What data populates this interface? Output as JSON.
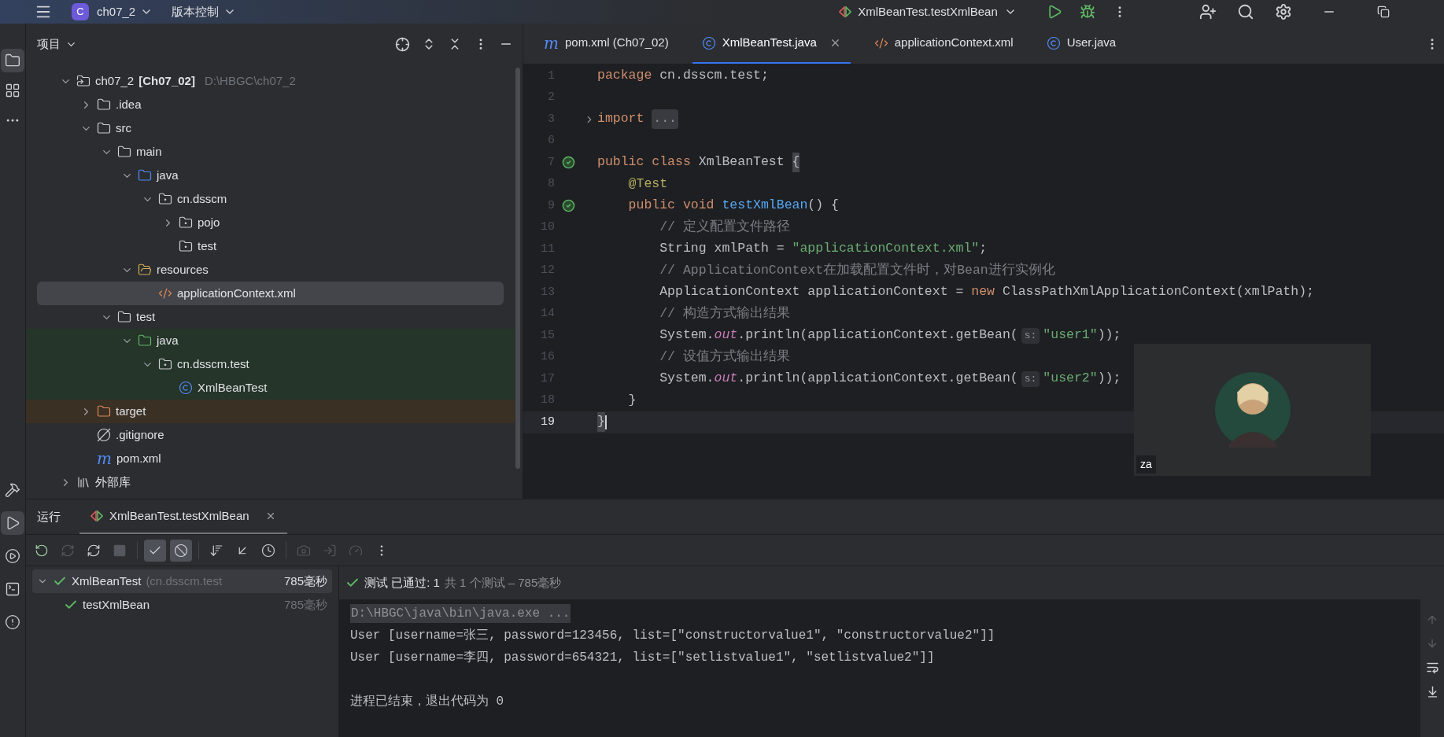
{
  "title_bar": {
    "project_badge": "C",
    "project": "ch07_2",
    "vcs": "版本控制",
    "run_config": "XmlBeanTest.testXmlBean"
  },
  "tool_strip": {
    "top": [
      {
        "kind": "project",
        "selected": true
      },
      {
        "kind": "structure",
        "selected": false
      },
      {
        "kind": "more",
        "selected": false
      }
    ],
    "bottom": [
      {
        "kind": "build",
        "selected": false
      },
      {
        "kind": "run",
        "selected": true
      },
      {
        "kind": "services",
        "selected": false
      },
      {
        "kind": "terminal",
        "selected": false
      },
      {
        "kind": "problems",
        "selected": false
      }
    ]
  },
  "project_panel": {
    "title": "项目",
    "tree": [
      {
        "label": "ch07_2",
        "bold": "[Ch07_02]",
        "path": "D:\\HBGC\\ch07_2",
        "kind": "module",
        "expanded": true,
        "selected": false,
        "children": [
          {
            "label": ".idea",
            "kind": "folder",
            "expanded": false,
            "selected": false
          },
          {
            "label": "src",
            "kind": "folder",
            "expanded": true,
            "selected": false,
            "children": [
              {
                "label": "main",
                "kind": "folder",
                "expanded": true,
                "selected": false,
                "children": [
                  {
                    "label": "java",
                    "kind": "source-folder",
                    "expanded": true,
                    "selected": false,
                    "children": [
                      {
                        "label": "cn.dsscm",
                        "kind": "package",
                        "expanded": true,
                        "selected": false,
                        "children": [
                          {
                            "label": "pojo",
                            "kind": "package",
                            "expanded": false,
                            "selected": false
                          },
                          {
                            "label": "test",
                            "kind": "package",
                            "selected": false
                          }
                        ]
                      }
                    ]
                  },
                  {
                    "label": "resources",
                    "kind": "resources",
                    "expanded": true,
                    "selected": false,
                    "children": [
                      {
                        "label": "applicationContext.xml",
                        "kind": "xml",
                        "selected": true
                      }
                    ]
                  }
                ]
              },
              {
                "label": "test",
                "kind": "folder",
                "expanded": true,
                "selected": false,
                "children": [
                  {
                    "label": "java",
                    "kind": "test-folder",
                    "expanded": true,
                    "selected": false,
                    "children": [
                      {
                        "label": "cn.dsscm.test",
                        "kind": "package",
                        "expanded": true,
                        "selected": false,
                        "children": [
                          {
                            "label": "XmlBeanTest",
                            "kind": "class",
                            "selected": false
                          }
                        ]
                      }
                    ]
                  }
                ]
              }
            ]
          },
          {
            "label": "target",
            "kind": "excluded-folder",
            "expanded": false,
            "selected": false
          },
          {
            "label": ".gitignore",
            "kind": "ignore",
            "selected": false
          },
          {
            "label": "pom.xml",
            "kind": "maven",
            "badge": "m",
            "selected": false
          }
        ]
      },
      {
        "label": "外部库",
        "kind": "library",
        "expanded": false,
        "selected": false
      }
    ]
  },
  "editor": {
    "tabs": [
      {
        "label": "pom.xml (Ch07_02)",
        "kind": "maven",
        "badge": "m",
        "selected": false,
        "closable": false
      },
      {
        "label": "XmlBeanTest.java",
        "kind": "class",
        "selected": true,
        "closable": true
      },
      {
        "label": "applicationContext.xml",
        "kind": "xml",
        "selected": false,
        "closable": false
      },
      {
        "label": "User.java",
        "kind": "class",
        "selected": false,
        "closable": false
      }
    ],
    "lines": [
      {
        "number": "1",
        "current": false,
        "tokens": [
          {
            "text": "package ",
            "kind": "keyword"
          },
          {
            "text": "cn.dsscm.test;",
            "kind": "plain"
          }
        ]
      },
      {
        "number": "2",
        "current": false
      },
      {
        "number": "3",
        "current": false,
        "folded": true,
        "tokens": [
          {
            "text": "import ",
            "kind": "keyword"
          },
          {
            "text": "...",
            "kind": "folded"
          }
        ]
      },
      {
        "number": "6",
        "current": false
      },
      {
        "number": "7",
        "current": false,
        "run_marker": true,
        "tokens": [
          {
            "text": "public class ",
            "kind": "keyword"
          },
          {
            "text": "XmlBeanTest ",
            "kind": "plain"
          },
          {
            "text": "{",
            "kind": "brace"
          }
        ]
      },
      {
        "number": "8",
        "current": false,
        "tokens": [
          {
            "text": "    @Test",
            "kind": "annotation"
          }
        ]
      },
      {
        "number": "9",
        "current": false,
        "run_marker": true,
        "tokens": [
          {
            "text": "    public void ",
            "kind": "keyword"
          },
          {
            "text": "testXmlBean",
            "kind": "method"
          },
          {
            "text": "() {",
            "kind": "plain"
          }
        ]
      },
      {
        "number": "10",
        "current": false,
        "tokens": [
          {
            "text": "        // 定义配置文件路径",
            "kind": "comment"
          }
        ]
      },
      {
        "number": "11",
        "current": false,
        "tokens": [
          {
            "text": "        String xmlPath = ",
            "kind": "plain"
          },
          {
            "text": "\"applicationContext.xml\"",
            "kind": "string"
          },
          {
            "text": ";",
            "kind": "plain"
          }
        ]
      },
      {
        "number": "12",
        "current": false,
        "tokens": [
          {
            "text": "        // ApplicationContext在加载配置文件时，对Bean进行实例化",
            "kind": "comment"
          }
        ]
      },
      {
        "number": "13",
        "current": false,
        "tokens": [
          {
            "text": "        ApplicationContext applicationContext = ",
            "kind": "plain"
          },
          {
            "text": "new ",
            "kind": "keyword"
          },
          {
            "text": "ClassPathXmlApplicationContext(xmlPath);",
            "kind": "plain"
          }
        ]
      },
      {
        "number": "14",
        "current": false,
        "tokens": [
          {
            "text": "        // 构造方式输出结果",
            "kind": "comment"
          }
        ]
      },
      {
        "number": "15",
        "current": false,
        "tokens": [
          {
            "text": "        System.",
            "kind": "plain"
          },
          {
            "text": "out",
            "kind": "static"
          },
          {
            "text": ".println(applicationContext.getBean(",
            "kind": "plain"
          },
          {
            "text": "s:",
            "kind": "hint"
          },
          {
            "text": "\"user1\"",
            "kind": "string"
          },
          {
            "text": "));",
            "kind": "plain"
          }
        ]
      },
      {
        "number": "16",
        "current": false,
        "tokens": [
          {
            "text": "        // 设值方式输出结果",
            "kind": "comment"
          }
        ]
      },
      {
        "number": "17",
        "current": false,
        "tokens": [
          {
            "text": "        System.",
            "kind": "plain"
          },
          {
            "text": "out",
            "kind": "static"
          },
          {
            "text": ".println(applicationContext.getBean(",
            "kind": "plain"
          },
          {
            "text": "s:",
            "kind": "hint"
          },
          {
            "text": "\"user2\"",
            "kind": "string"
          },
          {
            "text": "));",
            "kind": "plain"
          }
        ]
      },
      {
        "number": "18",
        "current": false,
        "tokens": [
          {
            "text": "    }",
            "kind": "plain"
          }
        ]
      },
      {
        "number": "19",
        "current": true,
        "tokens": [
          {
            "text": "}",
            "kind": "brace"
          }
        ]
      }
    ]
  },
  "webcam": {
    "kind": "picture",
    "label": "za"
  },
  "run_panel": {
    "title": "运行",
    "tab": {
      "label": "XmlBeanTest.testXmlBean",
      "selected": true
    },
    "toolbar": [
      {
        "kind": "rerun",
        "selected": false,
        "disabled": false
      },
      {
        "kind": "rerun-failed",
        "selected": false,
        "disabled": true
      },
      {
        "kind": "toggle-auto",
        "selected": false,
        "disabled": false
      },
      {
        "kind": "stop",
        "selected": false,
        "disabled": true
      },
      {
        "kind": "separator"
      },
      {
        "kind": "show-passed",
        "selected": true,
        "disabled": false
      },
      {
        "kind": "show-ignored",
        "selected": true,
        "disabled": false
      },
      {
        "kind": "separator"
      },
      {
        "kind": "sort",
        "selected": false,
        "disabled": false
      },
      {
        "kind": "import",
        "selected": false,
        "disabled": false
      },
      {
        "kind": "history",
        "selected": false,
        "disabled": false
      },
      {
        "kind": "separator"
      },
      {
        "kind": "camera",
        "selected": false,
        "disabled": true
      },
      {
        "kind": "export",
        "selected": false,
        "disabled": true
      },
      {
        "kind": "coverage",
        "selected": false,
        "disabled": true
      },
      {
        "kind": "more",
        "selected": false,
        "disabled": false
      }
    ],
    "tests": [
      {
        "name": "XmlBeanTest",
        "detail": "(cn.dsscm.test",
        "time": "785毫秒",
        "passed": true,
        "expanded": true,
        "selected": true,
        "children": [
          {
            "name": "testXmlBean",
            "time": "785毫秒",
            "passed": true,
            "selected": false
          }
        ]
      }
    ],
    "status": {
      "passed": true,
      "result": "测试 已通过: 1",
      "summary": "共 1 个测试 – 785毫秒"
    },
    "console": [
      {
        "kind": "command",
        "text": "D:\\HBGC\\java\\bin\\java.exe ..."
      },
      {
        "kind": "output",
        "text": "User [username=张三, password=123456, list=[\"constructorvalue1\", \"constructorvalue2\"]]"
      },
      {
        "kind": "output",
        "text": "User [username=李四, password=654321, list=[\"setlistvalue1\", \"setlistvalue2\"]]"
      },
      {
        "kind": "blank"
      },
      {
        "kind": "output",
        "text": "进程已结束，退出代码为 0"
      }
    ]
  }
}
